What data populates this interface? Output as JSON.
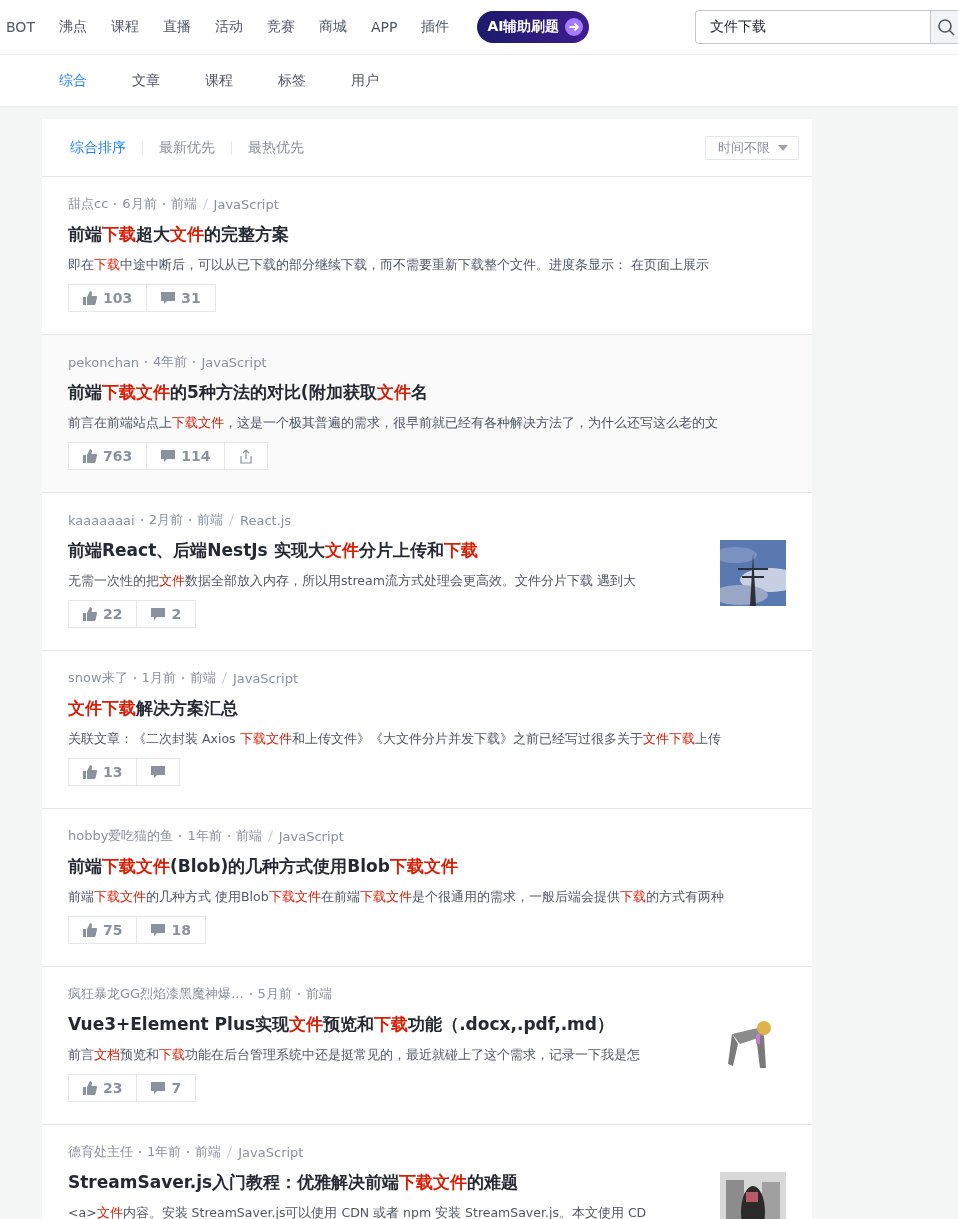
{
  "nav": {
    "items": [
      {
        "label": "BOT"
      },
      {
        "label": "沸点"
      },
      {
        "label": "课程"
      },
      {
        "label": "直播"
      },
      {
        "label": "活动"
      },
      {
        "label": "竞赛"
      },
      {
        "label": "商城"
      },
      {
        "label": "APP"
      },
      {
        "label": "插件"
      }
    ],
    "promo": "AI辅助刷题",
    "search": {
      "value": "文件下载"
    }
  },
  "tabs": [
    {
      "label": "综合",
      "selected": true
    },
    {
      "label": "文章",
      "selected": false
    },
    {
      "label": "课程",
      "selected": false
    },
    {
      "label": "标签",
      "selected": false
    },
    {
      "label": "用户",
      "selected": false
    }
  ],
  "sort": [
    {
      "label": "综合排序",
      "selected": true
    },
    {
      "label": "最新优先",
      "selected": false
    },
    {
      "label": "最热优先",
      "selected": false
    }
  ],
  "time_filter": "时间不限",
  "articles": [
    {
      "author": "甜点cc",
      "time": "6月前",
      "tags": [
        "前端",
        "JavaScript"
      ],
      "title": [
        {
          "text": "前端"
        },
        {
          "text": "下载",
          "em": true
        },
        {
          "text": "超大"
        },
        {
          "text": "文件",
          "em": true
        },
        {
          "text": "的完整方案"
        }
      ],
      "snippet": [
        {
          "text": "即在"
        },
        {
          "text": "下载",
          "em": true
        },
        {
          "text": "中途中断后，可以从已下载的部分继续下载，而不需要重新下载整个文件。进度条显示： 在页面上展示"
        }
      ],
      "likes": "103",
      "comments": "31",
      "share": false,
      "thumbnail": false,
      "hovered": false
    },
    {
      "author": "pekonchan",
      "time": "4年前",
      "tags": [
        "JavaScript"
      ],
      "title": [
        {
          "text": "前端"
        },
        {
          "text": "下载文件",
          "em": true
        },
        {
          "text": "的5种方法的对比(附加获取"
        },
        {
          "text": "文件",
          "em": true
        },
        {
          "text": "名"
        }
      ],
      "snippet": [
        {
          "text": "前言在前端站点上"
        },
        {
          "text": "下载文件",
          "em": true
        },
        {
          "text": "，这是一个极其普遍的需求，很早前就已经有各种解决方法了，为什么还写这么老的文"
        }
      ],
      "likes": "763",
      "comments": "114",
      "share": true,
      "thumbnail": false,
      "hovered": true
    },
    {
      "author": "kaaaaaaai",
      "time": "2月前",
      "tags": [
        "前端",
        "React.js"
      ],
      "title": [
        {
          "text": "前端React、后端NestJs 实现大"
        },
        {
          "text": "文件",
          "em": true
        },
        {
          "text": "分片上传和"
        },
        {
          "text": "下载",
          "em": true
        }
      ],
      "snippet": [
        {
          "text": "无需一次性的把"
        },
        {
          "text": "文件",
          "em": true
        },
        {
          "text": "数据全部放入内存，所以用stream流方式处理会更高效。文件分片下载 遇到大"
        }
      ],
      "likes": "22",
      "comments": "2",
      "share": false,
      "thumbnail": true,
      "hovered": false
    },
    {
      "author": "snow来了",
      "time": "1月前",
      "tags": [
        "前端",
        "JavaScript"
      ],
      "title": [
        {
          "text": "文件下载",
          "em": true
        },
        {
          "text": "解决方案汇总"
        }
      ],
      "snippet": [
        {
          "text": "关联文章：《二次封装 Axios "
        },
        {
          "text": "下载文件",
          "em": true
        },
        {
          "text": "和上传文件》《大文件分片并发下载》之前已经写过很多关于"
        },
        {
          "text": "文件下载",
          "em": true
        },
        {
          "text": "上传"
        }
      ],
      "likes": "13",
      "share": false,
      "thumbnail": false,
      "hovered": false
    },
    {
      "author": "hobby爱吃猫的鱼",
      "time": "1年前",
      "tags": [
        "前端",
        "JavaScript"
      ],
      "title": [
        {
          "text": "前端"
        },
        {
          "text": "下载文件",
          "em": true
        },
        {
          "text": "(Blob)的几种方式使用Blob"
        },
        {
          "text": "下载文件",
          "em": true
        }
      ],
      "snippet": [
        {
          "text": "前端"
        },
        {
          "text": "下载文件",
          "em": true
        },
        {
          "text": "的几种方式 使用Blob"
        },
        {
          "text": "下载文件",
          "em": true
        },
        {
          "text": "在前端"
        },
        {
          "text": "下载文件",
          "em": true
        },
        {
          "text": "是个很通用的需求，一般后端会提供"
        },
        {
          "text": "下载",
          "em": true
        },
        {
          "text": "的方式有两种"
        }
      ],
      "likes": "75",
      "comments": "18",
      "share": false,
      "thumbnail": false,
      "hovered": false
    },
    {
      "author": "疯狂暴龙GG烈焰漆黑魔神爆...",
      "time": "5月前",
      "tags": [
        "前端"
      ],
      "title": [
        {
          "text": "Vue3+Element Plus实现"
        },
        {
          "text": "文件",
          "em": true
        },
        {
          "text": "预览和"
        },
        {
          "text": "下载",
          "em": true
        },
        {
          "text": "功能（.docx,.pdf,.md）"
        }
      ],
      "snippet": [
        {
          "text": "前言"
        },
        {
          "text": "文档",
          "em": true
        },
        {
          "text": "预览和"
        },
        {
          "text": "下载",
          "em": true
        },
        {
          "text": "功能在后台管理系统中还是挺常见的，最近就碰上了这个需求，记录一下我是怎"
        }
      ],
      "likes": "23",
      "comments": "7",
      "share": false,
      "thumbnail": true,
      "hovered": false
    },
    {
      "author": "德育处主任",
      "time": "1年前",
      "tags": [
        "前端",
        "JavaScript"
      ],
      "title": [
        {
          "text": "StreamSaver.js入门教程：优雅解决前端"
        },
        {
          "text": "下载文件",
          "em": true
        },
        {
          "text": "的难题"
        }
      ],
      "snippet": [
        {
          "text": "<a>"
        },
        {
          "text": "文件",
          "em": true
        },
        {
          "text": "内容。安装 StreamSaver.js可以使用 CDN 或者 npm 安装 StreamSaver.js。本文使用 CD"
        }
      ],
      "thumbnail": true,
      "hovered": false
    }
  ]
}
